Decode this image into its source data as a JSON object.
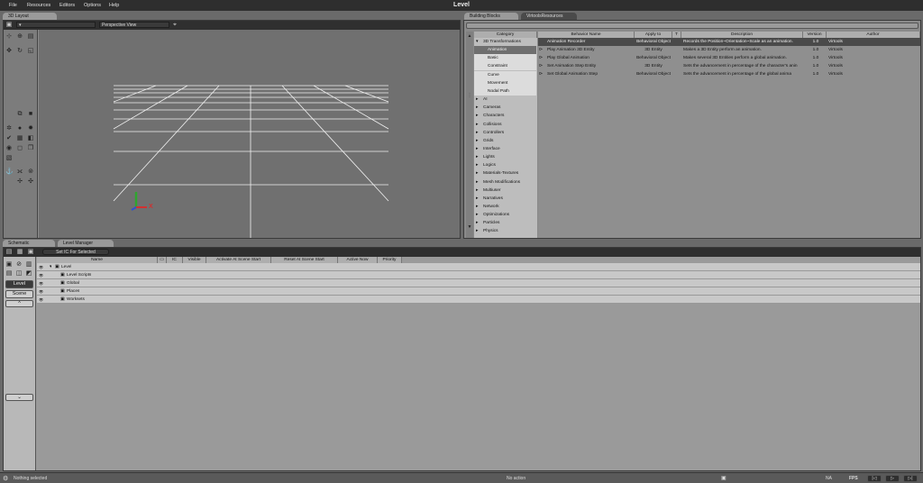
{
  "window": {
    "title": "Level"
  },
  "menu": [
    "File",
    "Resources",
    "Editors",
    "Options",
    "Help"
  ],
  "layout3d": {
    "tab": "3D Layout",
    "camera": "Perspective View"
  },
  "bb": {
    "tabs": [
      "Building Blocks",
      "VirtoolsResources"
    ],
    "cat_header": "Category",
    "columns": [
      "Behavior Name",
      "Apply to",
      "T",
      "Description",
      "Version",
      "Author"
    ],
    "categories": [
      {
        "label": "3D Transformations",
        "open": true,
        "level": 0
      },
      {
        "label": "Animation",
        "level": 1,
        "hl": true
      },
      {
        "label": "Basic",
        "level": 1
      },
      {
        "label": "Constraint",
        "level": 1
      },
      {
        "label": "Curve",
        "level": 1
      },
      {
        "label": "Movement",
        "level": 1
      },
      {
        "label": "Nodal Path",
        "level": 1
      },
      {
        "label": "AI",
        "level": 0
      },
      {
        "label": "Cameras",
        "level": 0
      },
      {
        "label": "Characters",
        "level": 0
      },
      {
        "label": "Collisions",
        "level": 0
      },
      {
        "label": "Controllers",
        "level": 0
      },
      {
        "label": "Grids",
        "level": 0
      },
      {
        "label": "Interface",
        "level": 0
      },
      {
        "label": "Lights",
        "level": 0
      },
      {
        "label": "Logics",
        "level": 0
      },
      {
        "label": "Materials-Textures",
        "level": 0
      },
      {
        "label": "Mesh Modifications",
        "level": 0
      },
      {
        "label": "Multiuser",
        "level": 0
      },
      {
        "label": "Narratives",
        "level": 0
      },
      {
        "label": "Network",
        "level": 0
      },
      {
        "label": "Optimizations",
        "level": 0
      },
      {
        "label": "Particles",
        "level": 0
      },
      {
        "label": "Physics",
        "level": 0
      }
    ],
    "rows": [
      {
        "name": "Animation Recorder",
        "apply": "Behavioral Object",
        "desc": "Records the Position~Orientation~Scale as an animation.",
        "version": "1.0",
        "author": "Virtools"
      },
      {
        "name": "Play Animation 3D Entity",
        "apply": "3D Entity",
        "desc": "Makes a 3D Entity perform an animation.",
        "version": "1.0",
        "author": "Virtools"
      },
      {
        "name": "Play Global Animation",
        "apply": "Behavioral Object",
        "desc": "Makes several 3D Entities perform a global animation.",
        "version": "1.0",
        "author": "Virtools"
      },
      {
        "name": "Set Animation Step Entity",
        "apply": "3D Entity",
        "desc": "Sets the advancement in percentage of the character's anin",
        "version": "1.0",
        "author": "Virtools"
      },
      {
        "name": "Set Global Animation Step",
        "apply": "Behavioral Object",
        "desc": "Sets the advancement in percentage of the global anima",
        "version": "1.0",
        "author": "Virtools"
      }
    ]
  },
  "bottom": {
    "tabs": [
      "Schematic",
      "Level Manager"
    ],
    "set_ic": "Set IC For Selected",
    "columns": [
      "Name",
      "IC",
      "Visible",
      "Activate At Scene Start",
      "Reset At Scene Start",
      "Active Now",
      "Priority"
    ],
    "rows": [
      "Level",
      "Level Scripts",
      "Global",
      "Places",
      "Worksets"
    ],
    "side_buttons": [
      "Level",
      "Scene"
    ]
  },
  "status": {
    "left": "Nothing selected",
    "middle": "No action",
    "na": "NA",
    "fps": "FPS"
  },
  "axes": {
    "x": "X"
  }
}
